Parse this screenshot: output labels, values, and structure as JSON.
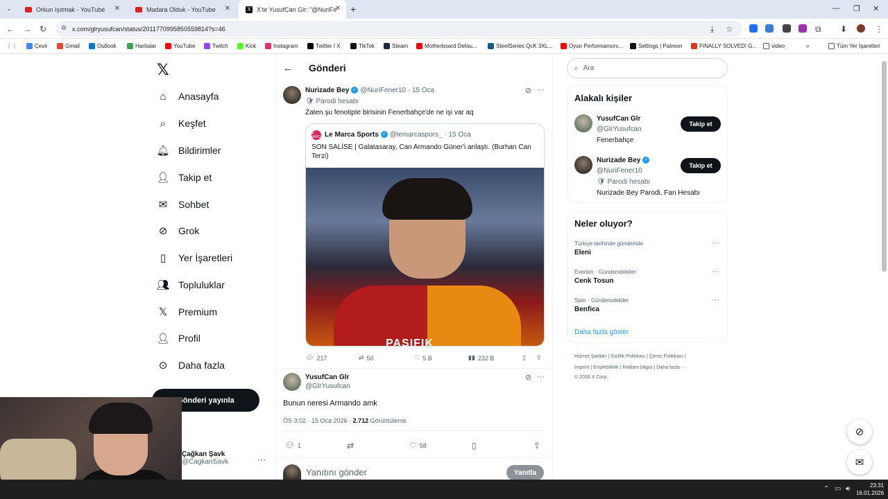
{
  "browser": {
    "tabs": [
      {
        "title": "Orkun Işıtmak - YouTube",
        "active": false
      },
      {
        "title": "Madara Olduk - YouTube",
        "active": false
      },
      {
        "title": "X'te YusufCan Glr: \"@NuriFene",
        "active": true
      }
    ],
    "url": "x.com/glryusufcan/status/2011770995850559814?s=46",
    "bookmarks": [
      "Çevir",
      "Gmail",
      "Outlook",
      "Haritalar",
      "YouTube",
      "Twitch",
      "Kick",
      "Instagram",
      "Twitter / X",
      "TikTok",
      "Steam",
      "Motherboard Defau...",
      "SteelSeries QcK 3XL...",
      "Oyun Performansını...",
      "Settings | Patreon",
      "FINALLY SOLVED! G...",
      "video"
    ],
    "all_bookmarks": "Tüm Yer İşaretleri"
  },
  "nav": {
    "items": [
      "Anasayfa",
      "Keşfet",
      "Bildirimler",
      "Takip et",
      "Sohbet",
      "Grok",
      "Yer İşaretleri",
      "Topluluklar",
      "Premium",
      "Profil",
      "Daha fazla"
    ],
    "post_button": "Gönderi yayınla",
    "account_name": "Çağkan Şavk",
    "account_handle": "@CagkanSavk"
  },
  "header": {
    "title": "Gönderi"
  },
  "tweet": {
    "name": "Nurizade Bey",
    "handle": "@NuriFener10",
    "date": "· 15 Oca",
    "parody": "Parodi hesabı",
    "text": "Zaten şu fenotipte birisinin Fenerbahçe'de ne işi var aq",
    "quote": {
      "name": "Le Marca Sports",
      "handle": "@lemarcaspors_",
      "date": "· 15 Oca",
      "text_line1": "SON SALİSE | Galatasaray, Can Armando Güner'i anlaştı. (Burhan Can",
      "text_line2": "Terzi)",
      "image_text": "PASIFIK"
    },
    "replies": "217",
    "retweets": "50",
    "likes": "5 B",
    "views": "232 B"
  },
  "reply": {
    "name": "YusufCan Glr",
    "handle": "@GlrYusufcan",
    "text": "Bunun neresi Armando amk",
    "time": "ÖS 3:02 · 15 Oca 2026 ·",
    "view_count": "2.712",
    "views_label": "Görüntüleme",
    "replies": "1",
    "likes": "58"
  },
  "composer": {
    "placeholder": "Yanıtını gönder",
    "button": "Yanıtla"
  },
  "sidebar": {
    "search_placeholder": "Ara",
    "people_title": "Alakalı kişiler",
    "people": [
      {
        "name": "YusufCan Glr",
        "handle": "@GlrYusufcan",
        "bio": "Fenerbahçe",
        "follow": "Takip et"
      },
      {
        "name": "Nurizade Bey",
        "handle": "@NuriFener10",
        "parody": "Parodi hesabı",
        "bio": "Nurizade Bey Parodi, Fan Hesabı",
        "follow": "Takip et"
      }
    ],
    "trends_title": "Neler oluyor?",
    "trends": [
      {
        "meta": "Türkiye tarihinde gündemde",
        "name": "Eleni"
      },
      {
        "meta": "Everton · Gündemdekiler",
        "name": "Cenk Tosun"
      },
      {
        "meta": "Spor · Gündemdekiler",
        "name": "Benfica"
      }
    ],
    "show_more": "Daha fazla göster",
    "footer_line1": "Hizmet Şartları  |  Gizlilik Politikası  |  Çerez Politikası  |",
    "footer_line2": "Imprint  |  Erişilebilirlik  |  Reklam bilgisi  |  Daha fazla ···",
    "footer_line3": "© 2026 X Corp."
  },
  "taskbar": {
    "time": "23:31",
    "date": "16.01.2026"
  },
  "colors": {
    "accent": "#1d9bf0",
    "text": "#0f1419",
    "muted": "#536471"
  }
}
